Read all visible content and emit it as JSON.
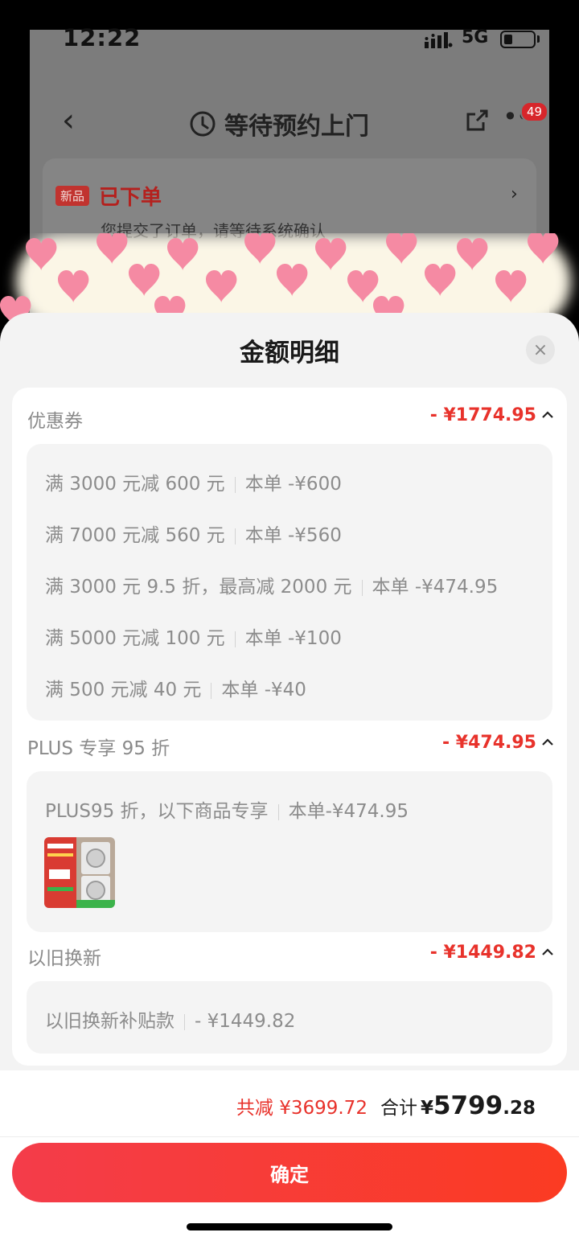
{
  "status_bar": {
    "time": "12:22",
    "network": "5G"
  },
  "background_page": {
    "title": "等待预约上门",
    "badge_count": "49",
    "order_card": {
      "tag": "新品",
      "status": "已下单",
      "description": "您提交了订单，请等待系统确认"
    }
  },
  "sheet": {
    "title": "金额明细",
    "close_icon": "×",
    "sections": [
      {
        "title": "优惠券",
        "amount": "- ¥1774.95",
        "rows": [
          {
            "text": "满 3000 元减 600 元",
            "detail": "本单 -¥600"
          },
          {
            "text": "满 7000 元减 560 元",
            "detail": "本单 -¥560"
          },
          {
            "text": "满 3000 元 9.5 折，最高减 2000 元",
            "detail": "本单 -¥474.95"
          },
          {
            "text": "满 5000 元减 100 元",
            "detail": "本单 -¥100"
          },
          {
            "text": "满 500 元减 40 元",
            "detail": "本单 -¥40"
          }
        ]
      },
      {
        "title": "PLUS 专享 95 折",
        "amount": "- ¥474.95",
        "rows": [
          {
            "text": "PLUS95 折，以下商品专享",
            "detail": "本单-¥474.95"
          }
        ]
      },
      {
        "title": "以旧换新",
        "amount": "- ¥1449.82",
        "rows": [
          {
            "text": "以旧换新补贴款",
            "detail": "- ¥1449.82"
          }
        ]
      }
    ],
    "footer": {
      "total_reduce": "共减 ¥3699.72",
      "total_label": "合计",
      "currency": "¥",
      "total_integer": "5799",
      "total_decimal": ".28",
      "confirm_label": "确定"
    }
  },
  "colors": {
    "accent_red": "#e8322b",
    "button_gradient_start": "#f43c4a",
    "button_gradient_end": "#fb3b22"
  }
}
